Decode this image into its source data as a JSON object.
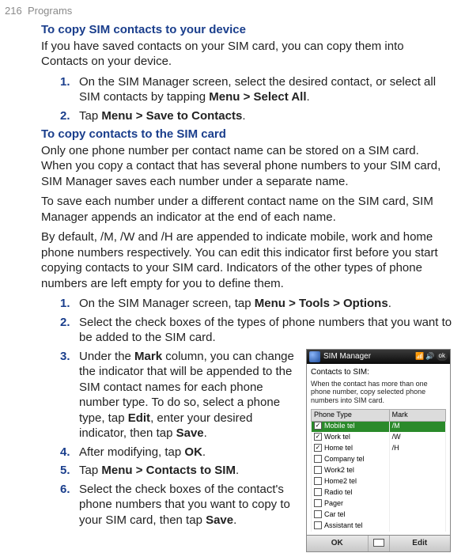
{
  "header": {
    "page_num": "216",
    "section": "Programs"
  },
  "sec1": {
    "title": "To copy SIM contacts to your device",
    "intro": "If you have saved contacts on your SIM card, you can copy them into Contacts on your device.",
    "items": [
      {
        "n": "1.",
        "pre": "On the SIM Manager screen, select the desired contact, or select all SIM contacts by tapping ",
        "b1": "Menu > Select All",
        "post": "."
      },
      {
        "n": "2.",
        "pre": "Tap ",
        "b1": "Menu > Save to Contacts",
        "post": "."
      }
    ]
  },
  "sec2": {
    "title": "To copy contacts to the SIM card",
    "p1": "Only one phone number per contact name can be stored on a SIM card. When you copy a contact that has several phone numbers to your SIM card, SIM Manager saves each number under a separate name.",
    "p2": "To save each number under a different contact name on the SIM card, SIM Manager appends an indicator at the end of each name.",
    "p3": "By default, /M, /W and /H are appended to indicate mobile, work and home phone numbers respectively. You can edit this indicator first before you start copying contacts to your SIM card. Indicators of the other types of phone numbers are left empty for you to define them.",
    "items": [
      {
        "n": "1.",
        "pre": "On the SIM Manager screen, tap ",
        "b1": "Menu > Tools > Options",
        "post": "."
      },
      {
        "n": "2.",
        "txt": "Select the check boxes of the types of phone numbers that you want to be added to the SIM card."
      },
      {
        "n": "3.",
        "pre": "Under the ",
        "b1": "Mark",
        "mid1": " column, you can change the indicator that will be appended to the SIM contact names for each phone number type. To do so, select a phone type, tap ",
        "b2": "Edit",
        "mid2": ", enter your desired indicator, then tap ",
        "b3": "Save",
        "post": "."
      },
      {
        "n": "4.",
        "pre": "After modifying, tap ",
        "b1": "OK",
        "post": "."
      },
      {
        "n": "5.",
        "pre": "Tap ",
        "b1": "Menu > Contacts to SIM",
        "post": "."
      },
      {
        "n": "6.",
        "pre": "Select the check boxes of the contact's phone numbers that you want to copy to your SIM card, then tap ",
        "b1": "Save",
        "post": "."
      }
    ]
  },
  "screenshot": {
    "title": "SIM Manager",
    "ok": "ok",
    "subtitle": "Contacts to SIM:",
    "desc": "When the contact has more than one phone number, copy selected phone numbers into SIM card.",
    "cols": {
      "phone": "Phone Type",
      "mark": "Mark"
    },
    "rows": [
      {
        "checked": true,
        "sel": true,
        "phone": "Mobile tel",
        "mark": "/M"
      },
      {
        "checked": true,
        "sel": false,
        "phone": "Work tel",
        "mark": "/W"
      },
      {
        "checked": true,
        "sel": false,
        "phone": "Home tel",
        "mark": "/H"
      },
      {
        "checked": false,
        "sel": false,
        "phone": "Company tel",
        "mark": ""
      },
      {
        "checked": false,
        "sel": false,
        "phone": "Work2 tel",
        "mark": ""
      },
      {
        "checked": false,
        "sel": false,
        "phone": "Home2 tel",
        "mark": ""
      },
      {
        "checked": false,
        "sel": false,
        "phone": "Radio tel",
        "mark": ""
      },
      {
        "checked": false,
        "sel": false,
        "phone": "Pager",
        "mark": ""
      },
      {
        "checked": false,
        "sel": false,
        "phone": "Car tel",
        "mark": ""
      },
      {
        "checked": false,
        "sel": false,
        "phone": "Assistant tel",
        "mark": ""
      }
    ],
    "softkeys": {
      "left": "OK",
      "right": "Edit"
    }
  }
}
